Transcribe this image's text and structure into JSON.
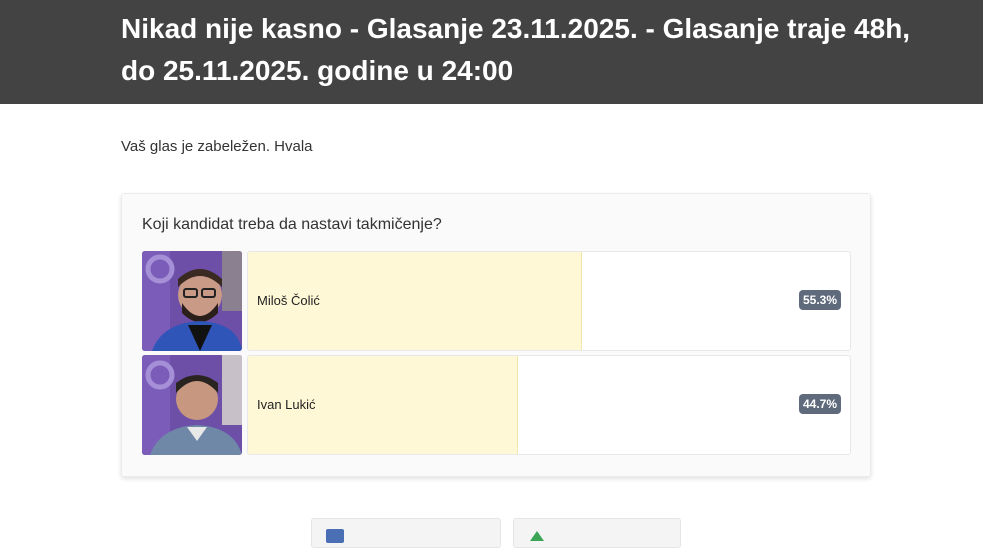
{
  "header": {
    "title": "Nikad nije kasno - Glasanje 23.11.2025. - Glasanje traje 48h, do 25.11.2025. godine u 24:00"
  },
  "message": "Vaš glas je zabeležen. Hvala",
  "poll": {
    "question": "Koji kandidat treba da nastavi takmičenje?",
    "options": [
      {
        "name": "Miloš Čolić",
        "percent_label": "55.3%",
        "percent": 55.3
      },
      {
        "name": "Ivan Lukić",
        "percent_label": "44.7%",
        "percent": 44.7
      }
    ]
  },
  "colors": {
    "header_bg": "#434343",
    "bar_fill": "#fff8d6",
    "badge_bg": "#5f6b7c",
    "avatar_bg": "#6a4ea6"
  },
  "icons": [
    "facebook-icon",
    "share-icon"
  ]
}
